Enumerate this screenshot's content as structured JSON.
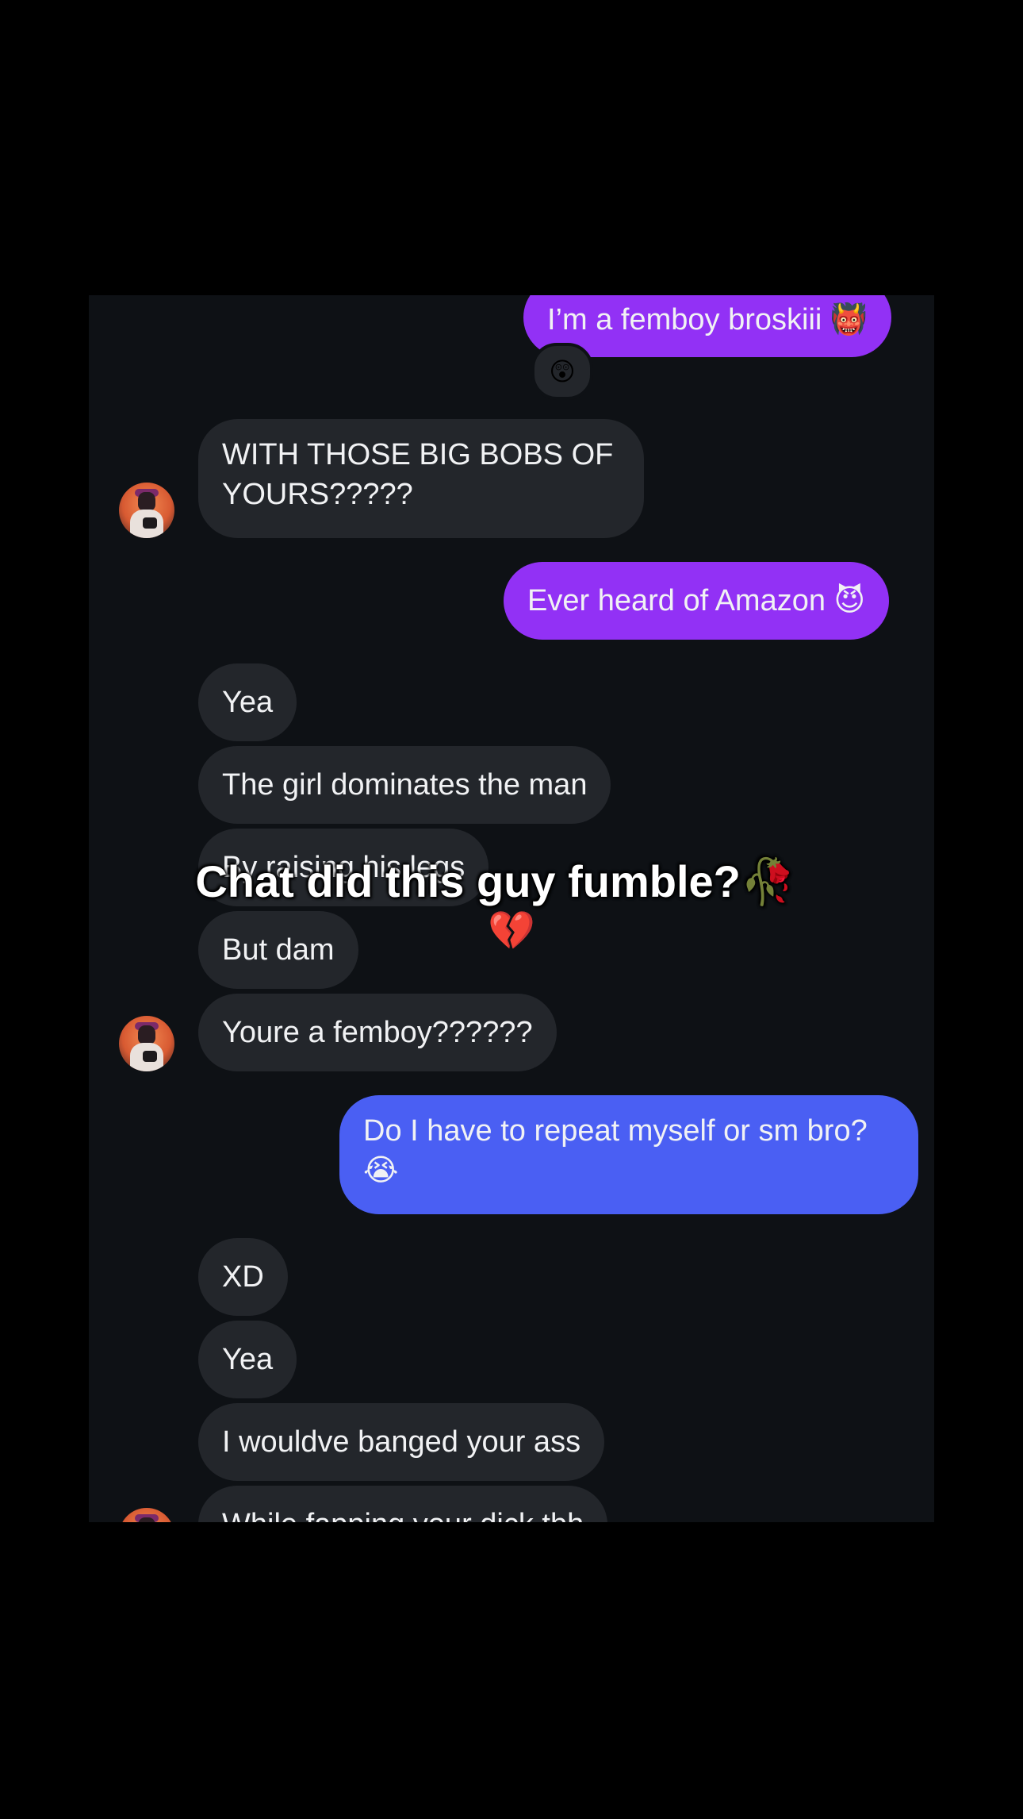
{
  "messages": {
    "m1": {
      "text": "I’m a femboy broskiii 👹",
      "reaction": "😲"
    },
    "m2": {
      "text": "WITH THOSE BIG BOBS OF YOURS?????"
    },
    "m3": {
      "text": "Ever heard of Amazon 😈"
    },
    "m4": {
      "text": "Yea"
    },
    "m5": {
      "text": "The girl dominates the man"
    },
    "m6": {
      "text": "By raising his legs"
    },
    "m7": {
      "text": "But dam"
    },
    "m8": {
      "text": "Youre a femboy??????"
    },
    "m9": {
      "text": "Do I have to repeat myself or sm bro? 😭"
    },
    "m10": {
      "text": "XD"
    },
    "m11": {
      "text": "Yea"
    },
    "m12": {
      "text": "I wouldve banged your ass"
    },
    "m13": {
      "text": "While fapping your dick tbh"
    }
  },
  "overlay": {
    "caption": "Chat did this guy fumble?🥀",
    "emoji": "💔"
  },
  "colors": {
    "chat_background": "#0e1115",
    "incoming_bubble": "#23262b",
    "outgoing_purple": "#9231f5",
    "outgoing_blue": "#4a5ff3"
  }
}
